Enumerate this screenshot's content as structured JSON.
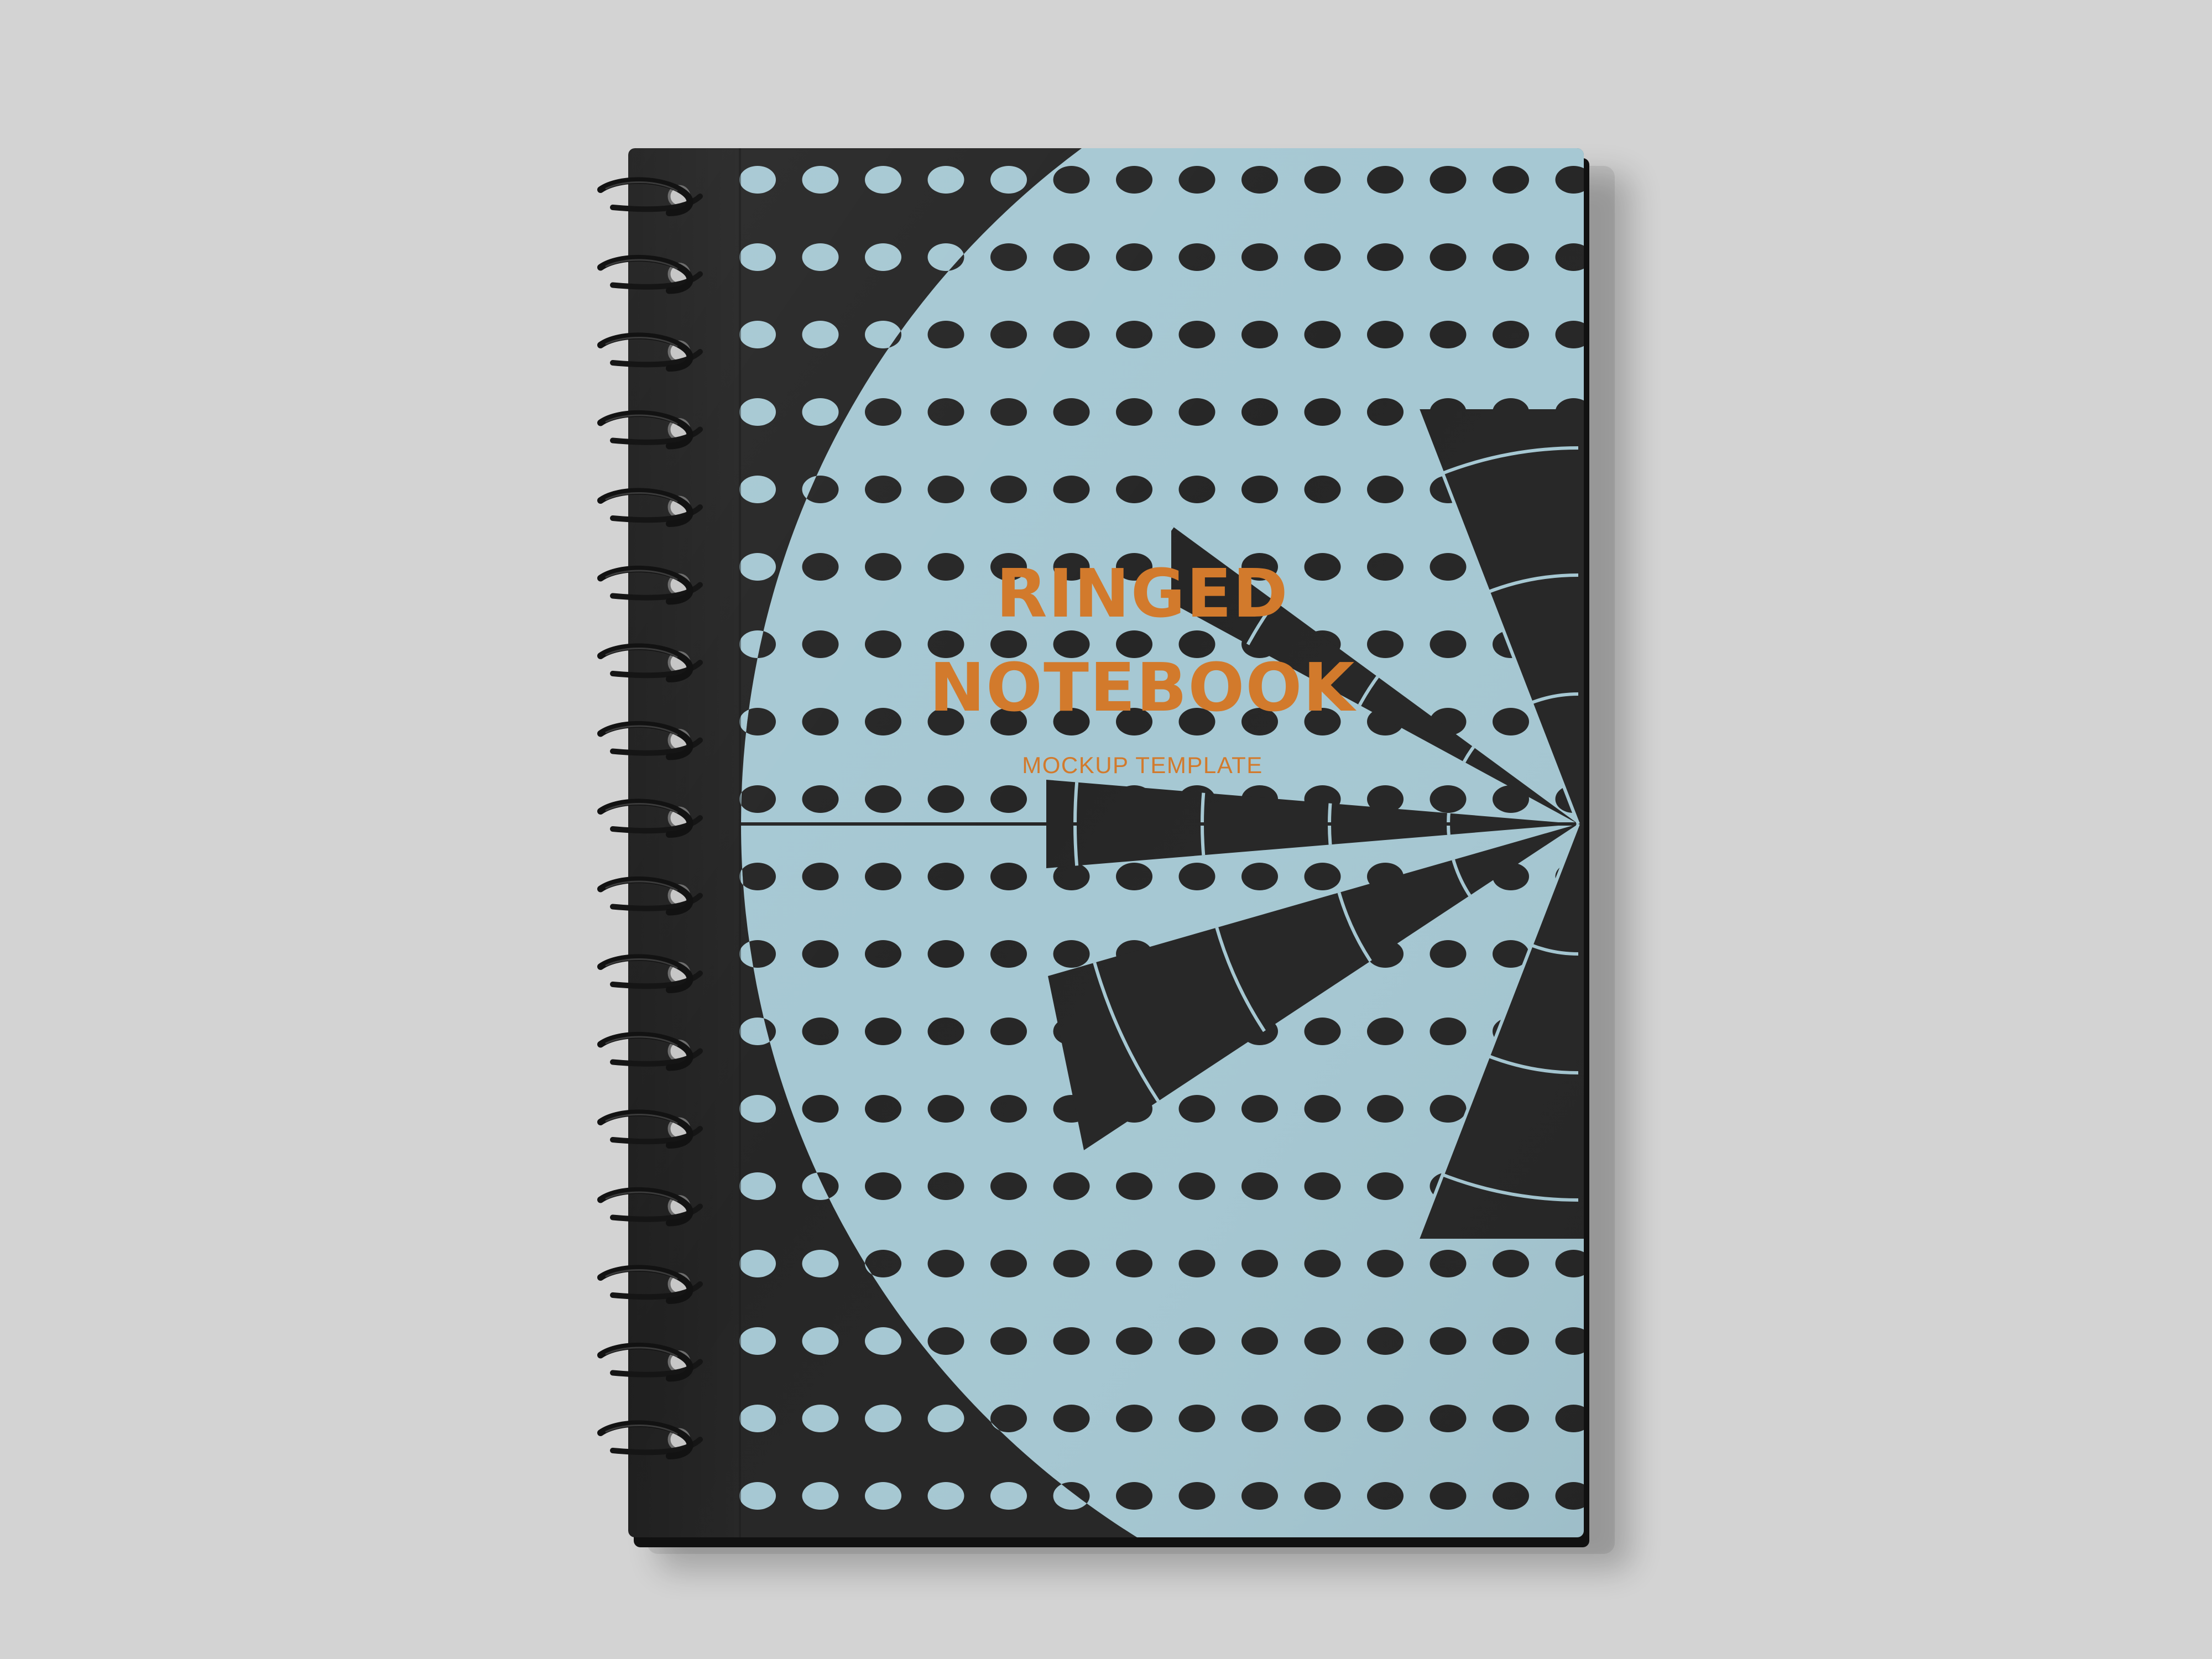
{
  "scene": {
    "background_color": "#d3d3d3",
    "subject": "spiral-bound notebook mockup"
  },
  "notebook": {
    "binding": "black wire spiral binding",
    "ring_count": 17,
    "cover_dark_color": "#262626",
    "cover_light_color": "#a6c8d3",
    "accent_color": "#d27a2c",
    "cover": {
      "title_line_1": "RINGED",
      "title_line_2": "NOTEBOOK",
      "subtitle": "MOCKUP TEMPLATE"
    }
  }
}
